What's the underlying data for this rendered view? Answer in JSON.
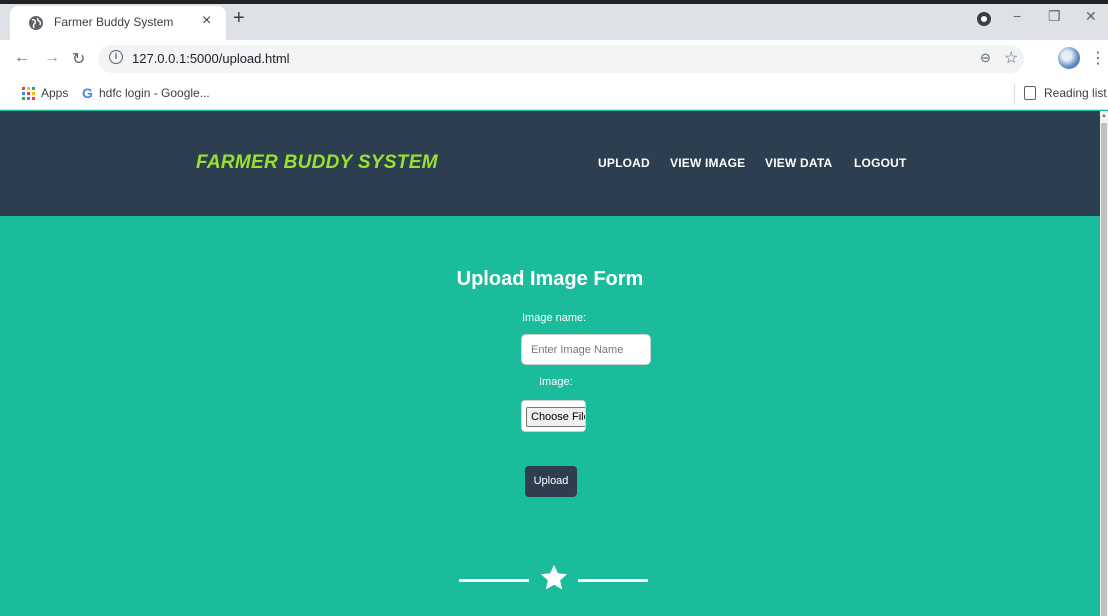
{
  "browser": {
    "tab_title": "Farmer Buddy System",
    "tab_close": "×",
    "new_tab": "+",
    "url": "127.0.0.1:5000/upload.html",
    "window_controls": [
      "−",
      "❐",
      "✕"
    ],
    "bookmarks": [
      {
        "label": "Apps"
      },
      {
        "label": "hdfc login - Google..."
      }
    ],
    "reading_list": "Reading list"
  },
  "navbar": {
    "brand": "FARMER BUDDY SYSTEM",
    "links": [
      "UPLOAD",
      "VIEW IMAGE",
      "VIEW DATA",
      "LOGOUT"
    ]
  },
  "form": {
    "title": "Upload Image Form",
    "name_label": "Image name:",
    "name_placeholder": "Enter Image Name",
    "image_label": "Image:",
    "file_button": "Choose File",
    "submit": "Upload"
  },
  "colors": {
    "page_bg": "#1abc9c",
    "navbar_bg": "#2c3e50",
    "brand": "#9ae030",
    "button_bg": "#2c3e50"
  }
}
